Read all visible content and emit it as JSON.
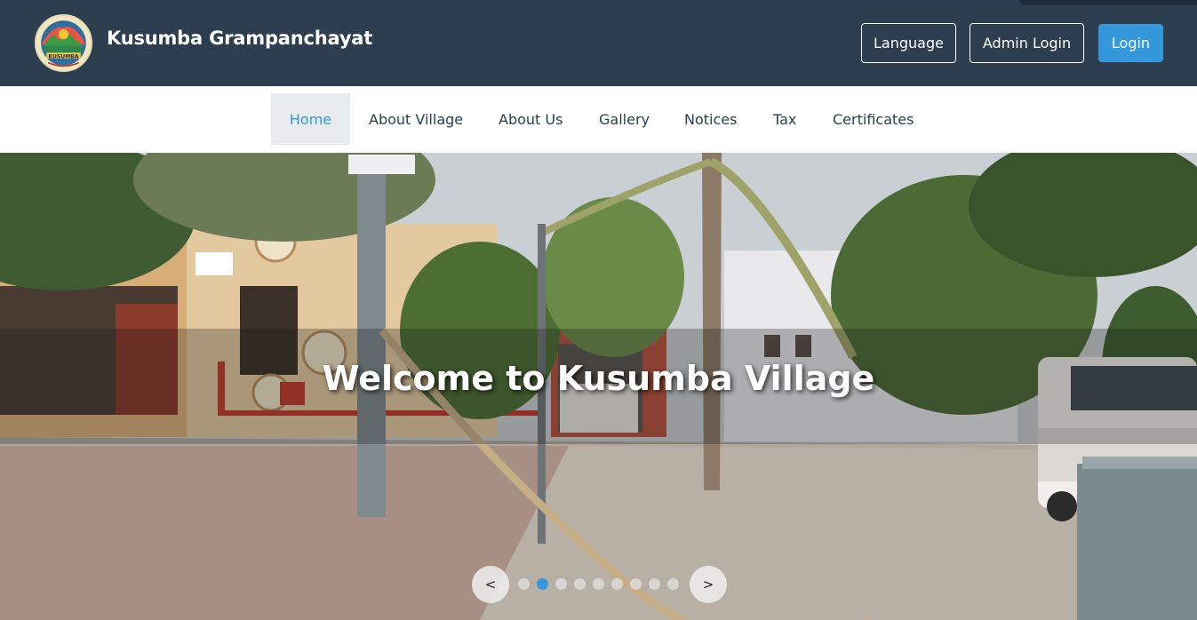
{
  "header": {
    "site_title": "Kusumba Grampanchayat",
    "logo_alt": "KUSUMBA",
    "language_label": "Language",
    "admin_login_label": "Admin Login",
    "login_label": "Login"
  },
  "nav": {
    "items": [
      {
        "label": "Home",
        "active": true
      },
      {
        "label": "About Village",
        "active": false
      },
      {
        "label": "About Us",
        "active": false
      },
      {
        "label": "Gallery",
        "active": false
      },
      {
        "label": "Notices",
        "active": false
      },
      {
        "label": "Tax",
        "active": false
      },
      {
        "label": "Certificates",
        "active": false
      }
    ]
  },
  "hero": {
    "title": "Welcome to Kusumba Village",
    "prev_label": "<",
    "next_label": ">",
    "slide_count": 9,
    "active_slide": 2
  },
  "colors": {
    "header_bg": "#2c3e50",
    "accent": "#3498db",
    "nav_text": "#2c3e50",
    "nav_active_bg": "#e9ecef"
  },
  "icons": {
    "logo": "village-logo-icon",
    "prev": "chevron-left-icon",
    "next": "chevron-right-icon"
  }
}
